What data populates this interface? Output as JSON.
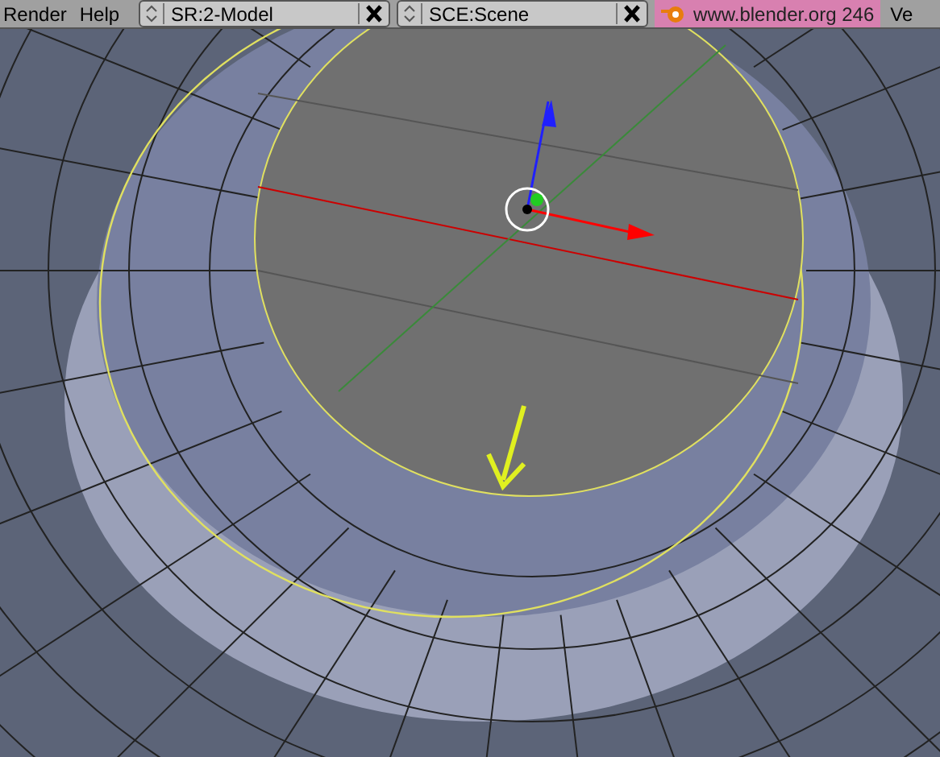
{
  "menu": [
    {
      "label": "Render"
    },
    {
      "label": "Help"
    }
  ],
  "screen_selector": {
    "value": "SR:2-Model"
  },
  "scene_selector": {
    "value": "SCE:Scene"
  },
  "version_text": "www.blender.org 246",
  "header_cut_text": "Ve"
}
